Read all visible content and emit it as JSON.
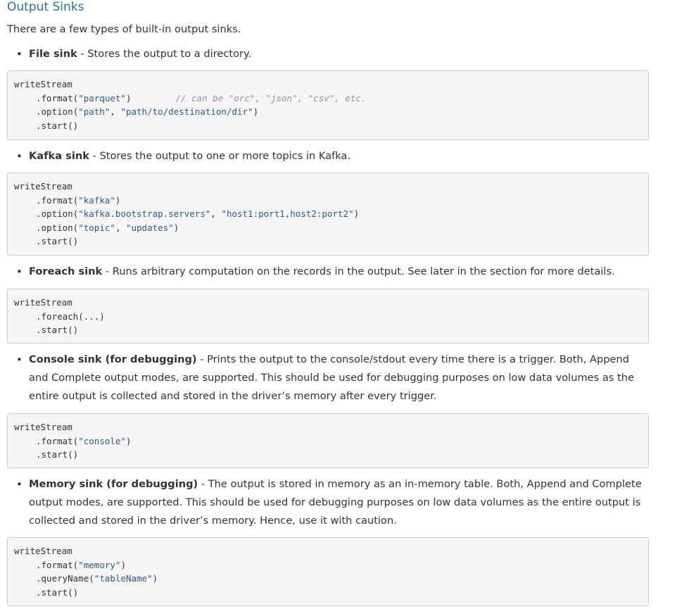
{
  "section_title": "Output Sinks",
  "intro": "There are a few types of built-in output sinks.",
  "sinks": [
    {
      "term": "File sink",
      "description": " - Stores the output to a directory.",
      "code": {
        "l1": "writeStream",
        "l2_pre": ".format(",
        "l2_str": "\"parquet\"",
        "l2_post": ")",
        "l2_comment": "// can be \"orc\", \"json\", \"csv\", etc.",
        "l3_pre": ".option(",
        "l3_str1": "\"path\"",
        "l3_sep": ", ",
        "l3_str2": "\"path/to/destination/dir\"",
        "l3_post": ")",
        "l4": ".start()"
      }
    },
    {
      "term": "Kafka sink",
      "description": " - Stores the output to one or more topics in Kafka.",
      "code": {
        "l1": "writeStream",
        "l2_pre": ".format(",
        "l2_str": "\"kafka\"",
        "l2_post": ")",
        "l3_pre": ".option(",
        "l3_str1": "\"kafka.bootstrap.servers\"",
        "l3_sep": ", ",
        "l3_str2": "\"host1:port1,host2:port2\"",
        "l3_post": ")",
        "l4_pre": ".option(",
        "l4_str1": "\"topic\"",
        "l4_sep": ", ",
        "l4_str2": "\"updates\"",
        "l4_post": ")",
        "l5": ".start()"
      }
    },
    {
      "term": "Foreach sink",
      "description": " - Runs arbitrary computation on the records in the output. See later in the section for more details.",
      "code": {
        "l1": "writeStream",
        "l2": ".foreach(...)",
        "l3": ".start()"
      }
    },
    {
      "term": "Console sink (for debugging)",
      "description": " - Prints the output to the console/stdout every time there is a trigger. Both, Append and Complete output modes, are supported. This should be used for debugging purposes on low data volumes as the entire output is collected and stored in the driver’s memory after every trigger.",
      "code": {
        "l1": "writeStream",
        "l2_pre": ".format(",
        "l2_str": "\"console\"",
        "l2_post": ")",
        "l3": ".start()"
      }
    },
    {
      "term": "Memory sink (for debugging)",
      "description": " - The output is stored in memory as an in-memory table. Both, Append and Complete output modes, are supported. This should be used for debugging purposes on low data volumes as the entire output is collected and stored in the driver’s memory. Hence, use it with caution.",
      "code": {
        "l1": "writeStream",
        "l2_pre": ".format(",
        "l2_str": "\"memory\"",
        "l2_post": ")",
        "l3_pre": ".queryName(",
        "l3_str": "\"tableName\"",
        "l3_post": ")",
        "l4": ".start()"
      }
    }
  ]
}
